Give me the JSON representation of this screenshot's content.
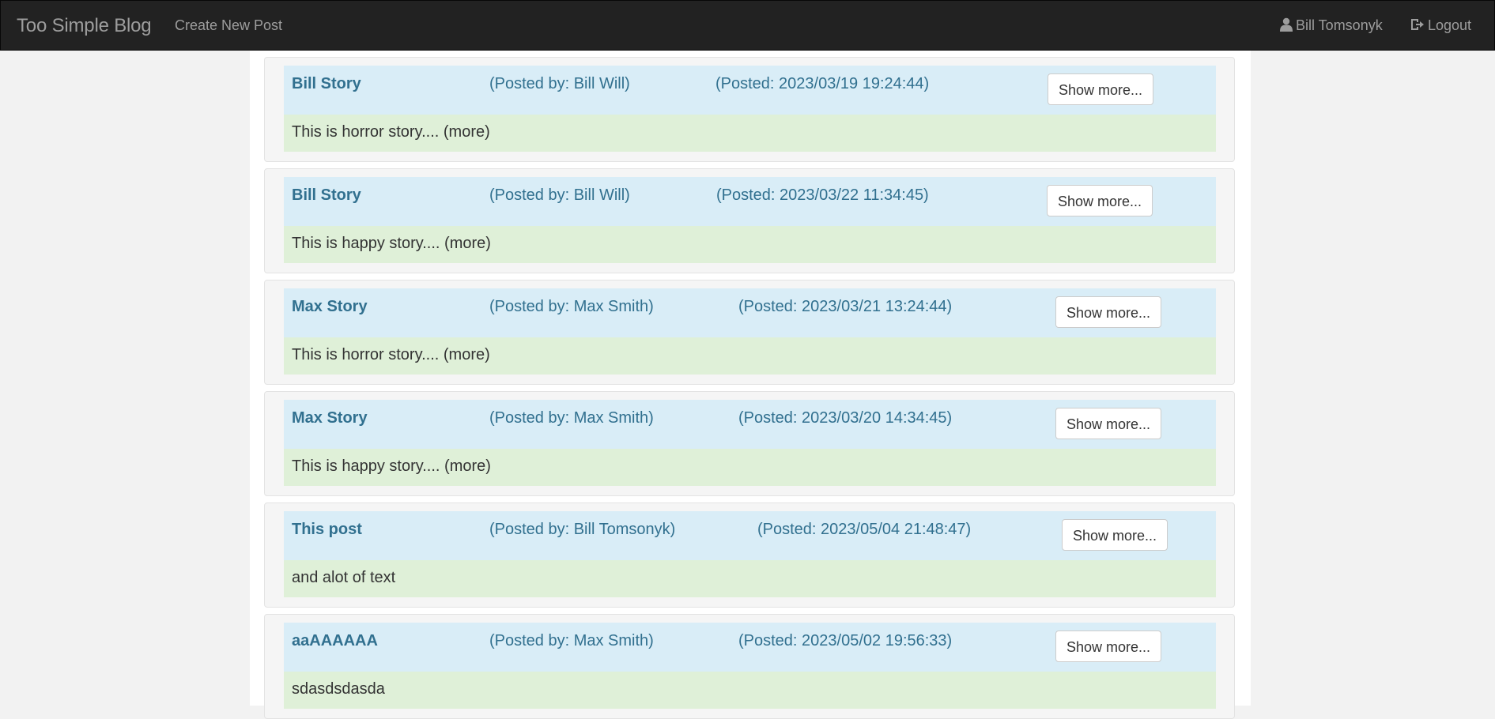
{
  "nav": {
    "brand": "Too Simple Blog",
    "create_label": "Create New Post",
    "user_name": "Bill Tomsonyk",
    "logout_label": "Logout",
    "user_icon": "user-icon",
    "logout_icon": "logout-icon"
  },
  "colors": {
    "navbar_bg": "#222222",
    "post_head_bg": "#d9edf7",
    "post_head_text": "#31708f",
    "post_body_bg": "#dff0d8"
  },
  "posts": [
    {
      "title": "Bill Story",
      "author": "(Posted by: Bill Will)",
      "date": "(Posted: 2023/03/19 19:24:44)",
      "text": "This is horror story.... (more)",
      "button": "Show more..."
    },
    {
      "title": "Bill Story",
      "author": "(Posted by: Bill Will)",
      "date": "(Posted: 2023/03/22 11:34:45)",
      "text": "This is happy story.... (more)",
      "button": "Show more..."
    },
    {
      "title": "Max Story",
      "author": "(Posted by: Max Smith)",
      "date": "(Posted: 2023/03/21 13:24:44)",
      "text": "This is horror story.... (more)",
      "button": "Show more..."
    },
    {
      "title": "Max Story",
      "author": "(Posted by: Max Smith)",
      "date": "(Posted: 2023/03/20 14:34:45)",
      "text": "This is happy story.... (more)",
      "button": "Show more..."
    },
    {
      "title": "This post",
      "author": "(Posted by: Bill Tomsonyk)",
      "date": "(Posted: 2023/05/04 21:48:47)",
      "text": "and alot of text",
      "button": "Show more..."
    },
    {
      "title": "aaAAAAAA",
      "author": "(Posted by: Max Smith)",
      "date": "(Posted: 2023/05/02 19:56:33)",
      "text": "sdasdsdasda",
      "button": "Show more..."
    }
  ]
}
